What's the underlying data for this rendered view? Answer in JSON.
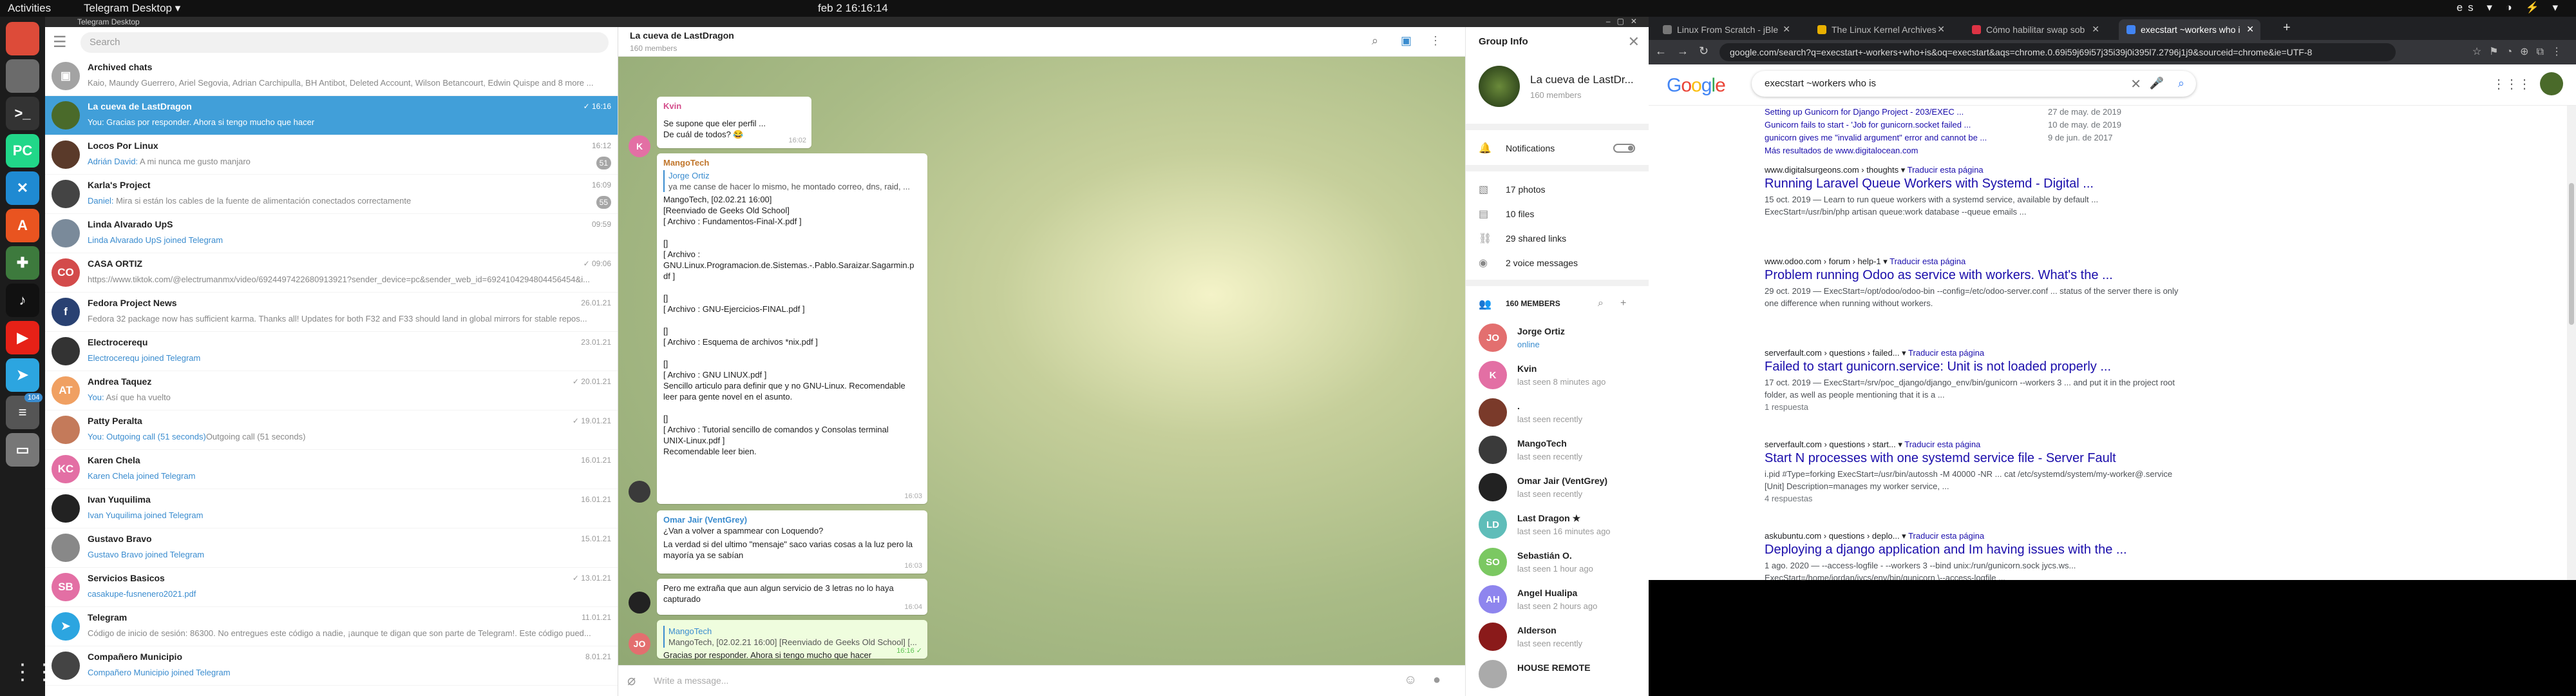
{
  "topbar": {
    "activities": "Activities",
    "app": "Telegram Desktop ▾",
    "clock": "feb 2  16:16:14",
    "tray": "es ▾ ◑ ⚡ ▾"
  },
  "dock": {
    "items": [
      {
        "name": "chrome-icon",
        "glyph": "",
        "color": "#dd4b39"
      },
      {
        "name": "files-icon",
        "glyph": "",
        "color": "#6b6b6b"
      },
      {
        "name": "terminal-icon",
        "glyph": ">_",
        "color": "#333"
      },
      {
        "name": "pycharm-icon",
        "glyph": "PC",
        "color": "#21d789"
      },
      {
        "name": "vscode-icon",
        "glyph": "✕",
        "color": "#1f8ad2"
      },
      {
        "name": "software-icon",
        "glyph": "A",
        "color": "#e95420"
      },
      {
        "name": "android-studio-icon",
        "glyph": "✚",
        "color": "#3d7a3d"
      },
      {
        "name": "tiktok-icon",
        "glyph": "♪",
        "color": "#111"
      },
      {
        "name": "youtube-icon",
        "glyph": "▶",
        "color": "#e62117"
      },
      {
        "name": "telegram-icon",
        "glyph": "➤",
        "color": "#2ca5e0"
      },
      {
        "name": "text-editor-icon",
        "glyph": "≡",
        "color": "#555"
      },
      {
        "name": "drive-icon",
        "glyph": "▭",
        "color": "#777"
      }
    ],
    "badge": "104",
    "grid": "⋮⋮⋮"
  },
  "telegram": {
    "window_title": "Telegram Desktop",
    "search_placeholder": "Search",
    "chats": [
      {
        "name": "Archived chats",
        "msg": "Kaio, Maundy Guerrero, Ariel Segovia, Adrian Carchipulla, BH Antibot, Deleted Account, Wilson Betancourt, Edwin Quispe and 8 more ...",
        "time": "",
        "badge": "",
        "av": "#a3a3a3",
        "init": "▣",
        "hl": ""
      },
      {
        "name": "La cueva de LastDragon",
        "msg": "Gracias por responder. Ahora si tengo mucho que hacer",
        "time": "✓ 16:16",
        "badge": "",
        "av": "#4a6a2a",
        "init": "",
        "hl": "You: ",
        "sel": true
      },
      {
        "name": "Locos Por Linux",
        "msg": "A mi nunca me gusto manjaro",
        "time": "16:12",
        "badge": "51",
        "av": "#5a3a2a",
        "init": "",
        "hl": "Adrián David: "
      },
      {
        "name": "Karla's Project",
        "msg": "Mira si están los cables de la fuente de alimentación conectados correctamente",
        "time": "16:09",
        "badge": "55",
        "av": "#444",
        "init": "",
        "hl": "Daniel: "
      },
      {
        "name": "Linda Alvarado UpS",
        "msg": "Linda Alvarado UpS joined Telegram",
        "time": "09:59",
        "badge": "",
        "av": "#7a8a9a",
        "init": "",
        "hl": "Linda Alvarado UpS joined Telegram"
      },
      {
        "name": "CASA ORTIZ",
        "msg": "https://www.tiktok.com/@electrumanmx/video/6924497422680913921?sender_device=pc&sender_web_id=6924104294804456454&i...",
        "time": "✓ 09:06",
        "badge": "",
        "av": "#d34b4b",
        "init": "CO",
        "hl": ""
      },
      {
        "name": "Fedora Project News",
        "msg": "Fedora 32 package now has sufficient karma. Thanks all! Updates for both F32 and F33 should land in global mirrors for stable repos...",
        "time": "26.01.21",
        "badge": "",
        "av": "#294172",
        "init": "f",
        "hl": ""
      },
      {
        "name": "Electrocerequ",
        "msg": "Electrocerequ joined Telegram",
        "time": "23.01.21",
        "badge": "",
        "av": "#333",
        "init": "",
        "hl": "Electrocerequ joined Telegram"
      },
      {
        "name": "Andrea Taquez",
        "msg": "Así que ha vuelto",
        "time": "✓ 20.01.21",
        "badge": "",
        "av": "#f0a062",
        "init": "AT",
        "hl": "You: "
      },
      {
        "name": "Patty Peralta",
        "msg": "Outgoing call (51 seconds)",
        "time": "✓ 19.01.21",
        "badge": "",
        "av": "#c47a5a",
        "init": "",
        "hl": "You: Outgoing call (51 seconds)"
      },
      {
        "name": "Karen Chela",
        "msg": "Karen Chela joined Telegram",
        "time": "16.01.21",
        "badge": "",
        "av": "#e36fa4",
        "init": "KC",
        "hl": "Karen Chela joined Telegram"
      },
      {
        "name": "Ivan Yuquilima",
        "msg": "Ivan Yuquilima joined Telegram",
        "time": "16.01.21",
        "badge": "",
        "av": "#222",
        "init": "",
        "hl": "Ivan Yuquilima joined Telegram"
      },
      {
        "name": "Gustavo Bravo",
        "msg": "Gustavo Bravo joined Telegram",
        "time": "15.01.21",
        "badge": "",
        "av": "#888",
        "init": "",
        "hl": "Gustavo Bravo joined Telegram"
      },
      {
        "name": "Servicios Basicos",
        "msg": "casakupe-fusnenero2021.pdf",
        "time": "✓ 13.01.21",
        "badge": "",
        "av": "#e36fa4",
        "init": "SB",
        "hl": "casakupe-fusnenero2021.pdf"
      },
      {
        "name": "Telegram",
        "msg": "Código de inicio de sesión: 86300. No entregues este código a nadie, ¡aunque te digan que son parte de Telegram!. Este código pued...",
        "time": "11.01.21",
        "badge": "",
        "av": "#2ca5e0",
        "init": "➤",
        "hl": ""
      },
      {
        "name": "Compañero Municipio",
        "msg": "Compañero Municipio joined Telegram",
        "time": "8.01.21",
        "badge": "",
        "av": "#444",
        "init": "",
        "hl": "Compañero Municipio joined Telegram"
      }
    ],
    "chat": {
      "title": "La cueva de LastDragon",
      "subtitle": "160 members",
      "compose_placeholder": "Write a message...",
      "kvin_name": "Kvin",
      "kvin_msg": "Se supone que eler perfil ...",
      "kvin_msg2": "De cuál de todos? 😂",
      "kvin_time": "16:02",
      "mango_name": "MangoTech",
      "mango_quote_name": "Jorge Ortiz",
      "mango_quote": "ya me canse de hacer lo mismo, he montado correo, dns, raid, ...",
      "mango_lines": [
        "MangoTech, [02.02.21 16:00]",
        "[Reenviado de Geeks Old School]",
        "[ Archivo : Fundamentos-Final-X.pdf ]",
        "",
        "[]",
        "[ Archivo :",
        "GNU.Linux.Programacion.de.Sistemas.-.Pablo.Saraizar.Sagarmin.p",
        "df ]",
        "",
        "[]",
        "[ Archivo : GNU-Ejercicios-FINAL.pdf ]",
        "",
        "[]",
        "[ Archivo : Esquema de archivos *nix.pdf ]",
        "",
        "[]",
        "[ Archivo : GNU LINUX.pdf ]",
        "Sencillo articulo para definir que y no GNU-Linux. Recomendable",
        "leer para gente novel en el asunto.",
        "",
        "[]",
        "[ Archivo : Tutorial sencillo de comandos y Consolas terminal",
        "UNIX-Linux.pdf ]",
        "Recomendable leer bien."
      ],
      "mango_time": "16:03",
      "omar_name": "Omar Jair (VentGrey)",
      "omar_q": "¿Van a volver a spammear con Loquendo?",
      "omar_msg": "La verdad si del ultimo \"mensaje\" saco varias cosas a la luz pero la mayoría ya se sabían",
      "omar_time": "16:03",
      "pero_msg": "Pero me extraña que aun algun servicio de 3 letras no lo haya capturado",
      "pero_time": "16:04",
      "reply_name": "MangoTech",
      "reply_quote": "MangoTech, [02.02.21 16:00] [Reenviado de Geeks Old School] [...",
      "reply_msg": "Gracias por responder. Ahora si tengo mucho que hacer",
      "reply_time": "16:16 ✓"
    },
    "info": {
      "title": "Group Info",
      "group_name": "La cueva de LastDr...",
      "group_sub": "160 members",
      "notifications": "Notifications",
      "photos": "17 photos",
      "files": "10 files",
      "links": "29 shared links",
      "voice": "2 voice messages",
      "members_header": "160 MEMBERS",
      "members": [
        {
          "name": "Jorge Ortiz",
          "status": "online",
          "av": "#e36f6f",
          "init": "JO",
          "on": true
        },
        {
          "name": "Kvin",
          "status": "last seen 8 minutes ago",
          "av": "#e36fa4",
          "init": "K"
        },
        {
          "name": ".",
          "status": "last seen recently",
          "av": "#7a3a2a",
          "init": ""
        },
        {
          "name": "MangoTech",
          "status": "last seen recently",
          "av": "#3a3a3a",
          "init": ""
        },
        {
          "name": "Omar Jair (VentGrey)",
          "status": "last seen recently",
          "av": "#222",
          "init": ""
        },
        {
          "name": "Last Dragon ★",
          "status": "last seen 16 minutes ago",
          "av": "#5fbdb9",
          "init": "LD"
        },
        {
          "name": "Sebastián O.",
          "status": "last seen 1 hour ago",
          "av": "#7bc862",
          "init": "SO"
        },
        {
          "name": "Angel Hualipa",
          "status": "last seen 2 hours ago",
          "av": "#8e85ee",
          "init": "AH"
        },
        {
          "name": "Alderson",
          "status": "last seen recently",
          "av": "#8a1a1a",
          "init": ""
        },
        {
          "name": "HOUSE REMOTE",
          "status": "",
          "av": "#aaa",
          "init": ""
        }
      ]
    }
  },
  "chrome": {
    "tabs": [
      {
        "label": "Linux From Scratch - jBle",
        "fav": "#777"
      },
      {
        "label": "The Linux Kernel Archives",
        "fav": "#e8b000"
      },
      {
        "label": "Cómo habilitar swap sob",
        "fav": "#d34"
      },
      {
        "label": "execstart ~workers who i",
        "fav": "#4285f4",
        "active": true
      }
    ],
    "new_tab": "+",
    "url": "google.com/search?q=execstart+-workers+who+is&oq=execstart&aqs=chrome.0.69i59j69i57j35i39j0i395l7.2796j1j9&sourceid=chrome&ie=UTF-8",
    "logo": "Google",
    "query": "execstart ~workers who is",
    "sitelinks": [
      {
        "label": "Setting up Gunicorn for Django Project - 203/EXEC ...",
        "date": "27 de may. de 2019"
      },
      {
        "label": "Gunicorn fails to start - 'Job for gunicorn.socket failed ...",
        "date": "10 de may. de 2019"
      },
      {
        "label": "gunicorn gives me \"invalid argument\" error and cannot be ...",
        "date": "9 de jun. de 2017"
      },
      {
        "label": "Más resultados de www.digitalocean.com",
        "date": ""
      }
    ],
    "results": [
      {
        "url": "www.digitalsurgeons.com › thoughts",
        "tr": "Traducir esta página",
        "title": "Running Laravel Queue Workers with Systemd - Digital ...",
        "snip": "15 oct. 2019 — Learn to run queue workers with a systemd service, available by default ... ExecStart=/usr/bin/php artisan queue:work database --queue emails ...",
        "more": ""
      },
      {
        "url": "www.odoo.com › forum › help-1",
        "tr": "Traducir esta página",
        "title": "Problem running Odoo as service with workers. What's the ...",
        "snip": "29 oct. 2019 — ExecStart=/opt/odoo/odoo-bin --config=/etc/odoo-server.conf ... status of the server there is only one difference when running without workers.",
        "more": ""
      },
      {
        "url": "serverfault.com › questions › failed...",
        "tr": "Traducir esta página",
        "title": "Failed to start gunicorn.service: Unit is not loaded properly ...",
        "snip": "17 oct. 2019 — ExecStart=/srv/poc_django/django_env/bin/gunicorn --workers 3 ... and put it in the project root folder, as well as people mentioning that it is a ...",
        "more": "1 respuesta"
      },
      {
        "url": "serverfault.com › questions › start...",
        "tr": "Traducir esta página",
        "title": "Start N processes with one systemd service file - Server Fault",
        "snip": "i.pid #Type=forking ExecStart=/usr/bin/autossh -M 40000 -NR ... cat /etc/systemd/system/my-worker@.service [Unit] Description=manages my worker service, ...",
        "more": "4 respuestas"
      },
      {
        "url": "askubuntu.com › questions › deplo...",
        "tr": "Traducir esta página",
        "title": "Deploying a django application and Im having issues with the ...",
        "snip": "1 ago. 2020 — --access-logfile - --workers 3 --bind unix:/run/gunicorn.sock jycs.ws... ExecStart=/home/jordan/jycs/env/bin/gunicorn \\--access-logfile ...",
        "more": ""
      }
    ]
  }
}
